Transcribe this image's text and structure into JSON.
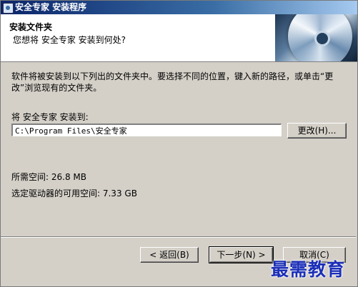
{
  "window": {
    "title": "安全专家 安装程序"
  },
  "header": {
    "title": "安装文件夹",
    "subtitle": "您想将 安全专家 安装到何处?"
  },
  "body": {
    "description": "软件将被安装到以下列出的文件夹中。要选择不同的位置，键入新的路径，或单击“更改”浏览现有的文件夹。",
    "install_label": "将 安全专家 安装到:",
    "install_path": "C:\\Program Files\\安全专家",
    "change_button": "更改(H)...",
    "space_required": "所需空间: 26.8 MB",
    "space_available": "选定驱动器的可用空间: 7.33 GB"
  },
  "footer": {
    "back_button": "< 返回(B)",
    "next_button": "下一步(N) >",
    "cancel_button": "取消(C)"
  },
  "watermark": "最需教育",
  "colors": {
    "titlebar_start": "#0a246a",
    "titlebar_end": "#a6caf0",
    "dialog_bg": "#d4d0c8",
    "watermark": "#1b2fb8"
  },
  "icons": [
    "app-icon",
    "cd-disc-image"
  ]
}
